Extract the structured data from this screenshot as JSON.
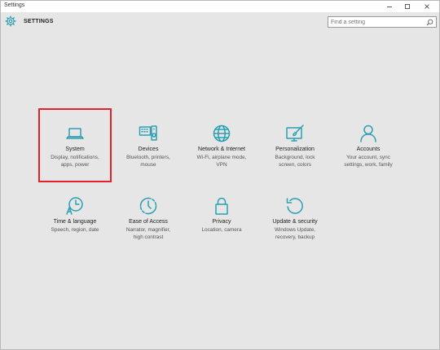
{
  "window": {
    "title": "Settings"
  },
  "header": {
    "heading": "SETTINGS",
    "search_placeholder": "Find a setting"
  },
  "tiles": [
    {
      "name": "System",
      "desc1": "Display, notifications,",
      "desc2": "apps, power",
      "icon": "laptop-icon"
    },
    {
      "name": "Devices",
      "desc1": "Bluetooth, printers,",
      "desc2": "mouse",
      "icon": "keyboard-speaker-icon"
    },
    {
      "name": "Network & Internet",
      "desc1": "Wi-Fi, airplane mode,",
      "desc2": "VPN",
      "icon": "globe-icon"
    },
    {
      "name": "Personalization",
      "desc1": "Background, lock",
      "desc2": "screen, colors",
      "icon": "paintbrush-monitor-icon"
    },
    {
      "name": "Accounts",
      "desc1": "Your account, sync",
      "desc2": "settings, work, family",
      "icon": "person-icon"
    },
    {
      "name": "Time & language",
      "desc1": "Speech, region, date",
      "desc2": "",
      "icon": "clock-language-icon"
    },
    {
      "name": "Ease of Access",
      "desc1": "Narrator, magnifier,",
      "desc2": "high contrast",
      "icon": "ease-of-access-icon"
    },
    {
      "name": "Privacy",
      "desc1": "Location, camera",
      "desc2": "",
      "icon": "lock-icon"
    },
    {
      "name": "Update & security",
      "desc1": "Windows Update,",
      "desc2": "recovery, backup",
      "icon": "refresh-icon"
    }
  ],
  "accent_color": "#2a9fb3",
  "highlight_color": "#e3222a"
}
